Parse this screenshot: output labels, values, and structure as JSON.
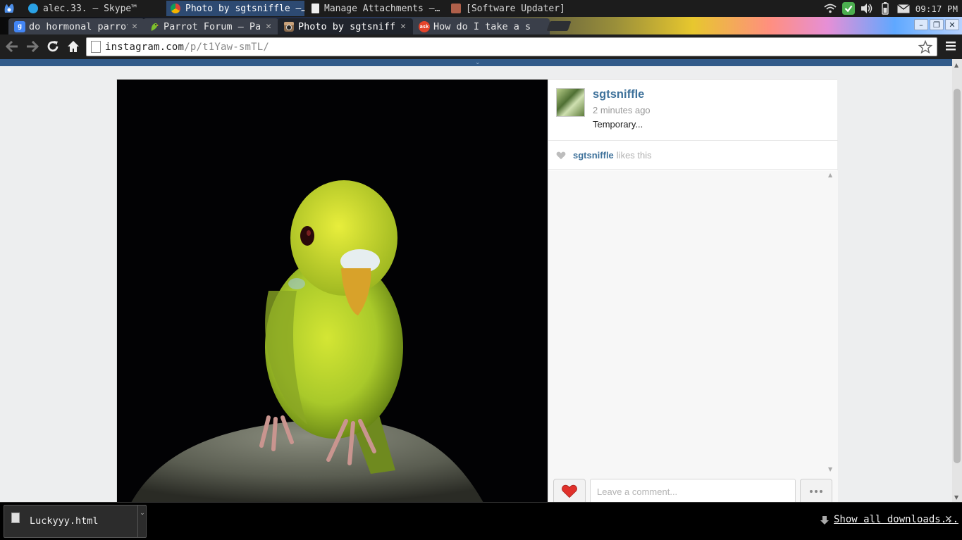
{
  "os_panel": {
    "tasks": [
      {
        "label": "alec.33. – Skype™",
        "icon": "skype-icon"
      },
      {
        "label": "Photo by sgtsniffle –…",
        "icon": "chrome-icon",
        "active": true
      },
      {
        "label": "Manage Attachments –…",
        "icon": "document-icon"
      },
      {
        "label": "[Software Updater]",
        "icon": "updater-icon"
      }
    ],
    "clock": "09:17 PM"
  },
  "tabs": [
    {
      "title": "do hormonal parrot",
      "favicon": "google-icon",
      "active": false
    },
    {
      "title": "Parrot Forum – Pa",
      "favicon": "parrot-forum-icon",
      "active": false
    },
    {
      "title": "Photo by sgtsniffle",
      "favicon": "instagram-icon",
      "active": true
    },
    {
      "title": "How do I take a s",
      "favicon": "ask-icon",
      "active": false
    }
  ],
  "toolbar": {
    "url_host": "instagram.com",
    "url_path": "/p/t1Yaw-smTL/"
  },
  "post": {
    "username": "sgtsniffle",
    "time_ago": "2 minutes ago",
    "caption": "Temporary...",
    "liker": "sgtsniffle",
    "likes_text": "likes this",
    "comment_placeholder": "Leave a comment..."
  },
  "downloads": {
    "filename": "Luckyyy.html",
    "show_all": "Show all downloads..."
  },
  "colors": {
    "instagram_blue": "#3f729b",
    "header_strip": "#325b8a",
    "like_heart": "#e0312b"
  }
}
